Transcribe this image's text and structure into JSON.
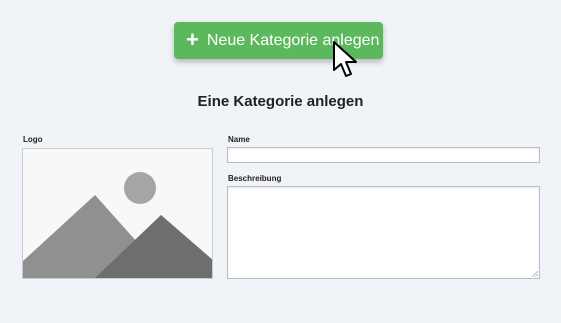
{
  "add_button": {
    "icon": "plus-icon",
    "label": "Neue Kategorie anlegen",
    "color": "#5cb85c"
  },
  "form": {
    "title": "Eine Kategorie anlegen",
    "logo_label": "Logo",
    "logo_placeholder_icon": "image-placeholder-icon",
    "name_label": "Name",
    "name_value": "",
    "description_label": "Beschreibung",
    "description_value": ""
  },
  "cursor": {
    "icon": "mouse-pointer-icon"
  }
}
